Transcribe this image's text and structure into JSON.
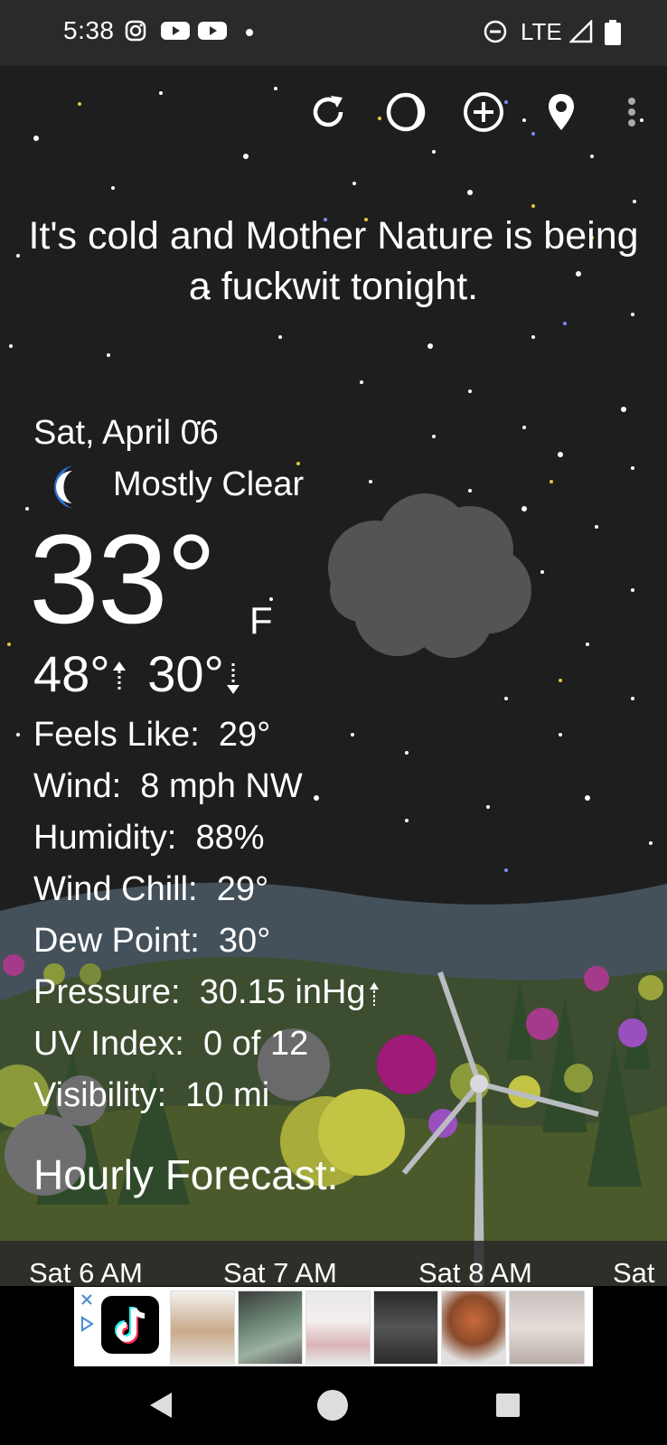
{
  "status_bar": {
    "time": "5:38",
    "left_icons": [
      "instagram-icon",
      "youtube-icon",
      "youtube-icon",
      "dot-icon"
    ],
    "right_icons": [
      "do-not-disturb-icon",
      "signal-icon",
      "battery-icon"
    ],
    "network": "LTE"
  },
  "toolbar": {
    "icons": [
      "refresh-icon",
      "theme-icon",
      "add-location-icon",
      "location-pin-icon",
      "overflow-menu-icon"
    ]
  },
  "headline": "It's cold and Mother Nature is being a fuckwit tonight.",
  "weather": {
    "date": "Sat, April 06",
    "condition": "Mostly Clear",
    "temperature": "33°",
    "unit": "F",
    "high": "48°",
    "low": "30°",
    "details": [
      {
        "label": "Feels Like:",
        "value": "29°"
      },
      {
        "label": "Wind:",
        "value": "8 mph NW"
      },
      {
        "label": "Humidity:",
        "value": "88%"
      },
      {
        "label": "Wind Chill:",
        "value": "29°"
      },
      {
        "label": "Dew Point:",
        "value": "30°"
      },
      {
        "label": "Pressure:",
        "value": "30.15 inHg"
      },
      {
        "label": "UV Index:",
        "value": "0 of 12"
      },
      {
        "label": "Visibility:",
        "value": "10 mi"
      }
    ]
  },
  "hourly": {
    "title": "Hourly Forecast:",
    "hours": [
      "Sat 6 AM",
      "Sat 7 AM",
      "Sat 8 AM",
      "Sat"
    ]
  },
  "colors": {
    "background": "#1e1e1e",
    "status_bar": "#2a2a2a",
    "moon": "#2f6fd6"
  }
}
